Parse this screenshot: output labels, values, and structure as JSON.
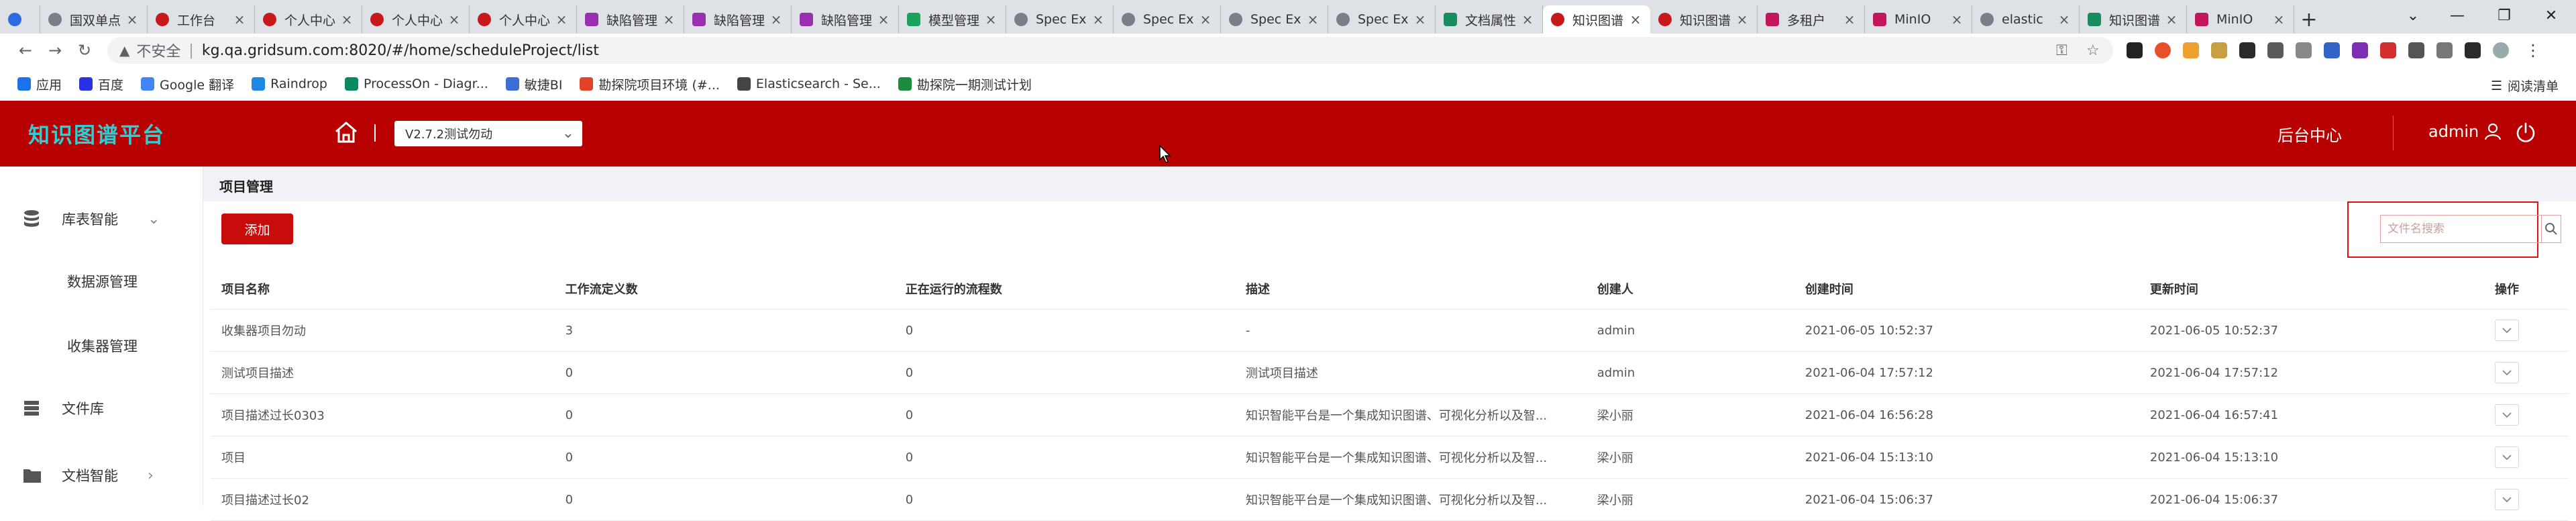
{
  "browser": {
    "tabs": [
      {
        "label": "",
        "icon": "cloud-favicon-icon"
      },
      {
        "label": "国双单点",
        "icon": "globe-icon"
      },
      {
        "label": "工作台",
        "icon": "gridsum-icon"
      },
      {
        "label": "个人中心",
        "icon": "gridsum-icon"
      },
      {
        "label": "个人中心",
        "icon": "gridsum-icon"
      },
      {
        "label": "个人中心",
        "icon": "gridsum-icon"
      },
      {
        "label": "缺陷管理",
        "icon": "bug-icon"
      },
      {
        "label": "缺陷管理",
        "icon": "bug-icon"
      },
      {
        "label": "缺陷管理",
        "icon": "bug-icon"
      },
      {
        "label": "模型管理",
        "icon": "model-icon"
      },
      {
        "label": "Spec Ex",
        "icon": "globe-icon"
      },
      {
        "label": "Spec Ex",
        "icon": "globe-icon"
      },
      {
        "label": "Spec Ex",
        "icon": "globe-icon"
      },
      {
        "label": "Spec Ex",
        "icon": "globe-icon"
      },
      {
        "label": "文档属性",
        "icon": "doc-icon"
      },
      {
        "label": "知识图谱",
        "icon": "kg-icon"
      },
      {
        "label": "知识图谱",
        "icon": "kg-icon"
      },
      {
        "label": "多租户",
        "icon": "tenant-icon"
      },
      {
        "label": "MinIO",
        "icon": "minio-icon"
      },
      {
        "label": "elastic",
        "icon": "elastic-icon"
      },
      {
        "label": "知识图谱",
        "icon": "vue-icon"
      },
      {
        "label": "MinIO",
        "icon": "minio-icon"
      }
    ],
    "new_tab": "+",
    "url": "kg.qa.gridsum.com:8020/#/home/scheduleProject/list",
    "insecure_label": "不安全",
    "bookmarks": [
      {
        "label": "应用",
        "color": "#1a73e8"
      },
      {
        "label": "百度",
        "color": "#2932e1"
      },
      {
        "label": "Google 翻译",
        "color": "#4285f4"
      },
      {
        "label": "Raindrop",
        "color": "#1e88e5"
      },
      {
        "label": "ProcessOn - Diagr...",
        "color": "#0a8a62"
      },
      {
        "label": "敏捷BI",
        "color": "#3b6fd6"
      },
      {
        "label": "勘探院项目环境 (#...",
        "color": "#e24329"
      },
      {
        "label": "Elasticsearch - Se...",
        "color": "#444444"
      },
      {
        "label": "勘探院一期测试计划",
        "color": "#1b8c3c"
      }
    ],
    "reading_list": "阅读清单"
  },
  "header": {
    "logo": "知识图谱平台",
    "project_select": "V2.7.2测试勿动",
    "backend_label": "后台中心",
    "user_name": "admin",
    "accent_color": "#b80000",
    "logo_color": "#2ad0d4"
  },
  "sidebar": {
    "groups": [
      {
        "label": "库表智能",
        "icon": "database-icon",
        "expanded": true,
        "children": [
          "数据源管理",
          "收集器管理"
        ]
      },
      {
        "label": "文件库",
        "icon": "storage-icon"
      },
      {
        "label": "文档智能",
        "icon": "folder-icon"
      }
    ]
  },
  "main": {
    "breadcrumb": "项目管理",
    "add_label": "添加",
    "search_placeholder": "文件名搜索",
    "columns": [
      "项目名称",
      "工作流定义数",
      "正在运行的流程数",
      "描述",
      "创建人",
      "创建时间",
      "更新时间",
      "操作"
    ],
    "rows": [
      [
        "收集器项目勿动",
        "3",
        "0",
        "-",
        "admin",
        "2021-06-05 10:52:37",
        "2021-06-05 10:52:37"
      ],
      [
        "测试项目描述",
        "0",
        "0",
        "测试项目描述",
        "admin",
        "2021-06-04 17:57:12",
        "2021-06-04 17:57:12"
      ],
      [
        "项目描述过长0303",
        "0",
        "0",
        "知识智能平台是一个集成知识图谱、可视化分析以及智...",
        "梁小丽",
        "2021-06-04 16:56:28",
        "2021-06-04 16:57:41"
      ],
      [
        "项目",
        "0",
        "0",
        "知识智能平台是一个集成知识图谱、可视化分析以及智...",
        "梁小丽",
        "2021-06-04 15:13:10",
        "2021-06-04 15:13:10"
      ],
      [
        "项目描述过长02",
        "0",
        "0",
        "知识智能平台是一个集成知识图谱、可视化分析以及智...",
        "梁小丽",
        "2021-06-04 15:06:37",
        "2021-06-04 15:06:37"
      ]
    ]
  }
}
